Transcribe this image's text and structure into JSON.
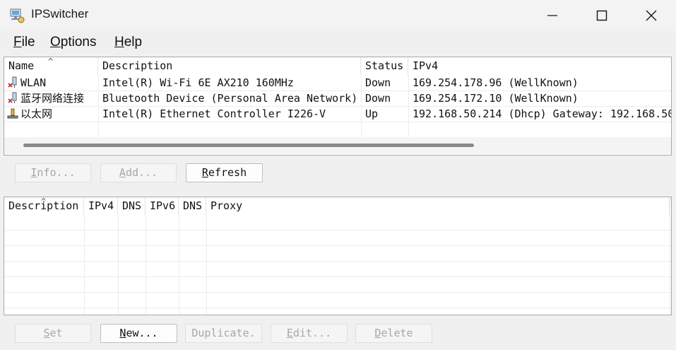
{
  "window": {
    "title": "IPSwitcher",
    "controls": {
      "minimize": "minimize",
      "maximize": "maximize",
      "close": "close"
    }
  },
  "menu": {
    "file": {
      "mnemonic": "F",
      "rest": "ile"
    },
    "options": {
      "mnemonic": "O",
      "rest": "ptions"
    },
    "help": {
      "mnemonic": "H",
      "rest": "elp"
    }
  },
  "adapters": {
    "columns": [
      "Name",
      "Description",
      "Status",
      "IPv4"
    ],
    "sort_indicator": "^",
    "rows": [
      {
        "name": "WLAN",
        "description": "Intel(R) Wi-Fi 6E AX210 160MHz",
        "status": "Down",
        "ipv4": "169.254.178.96 (WellKnown)",
        "icon": "network-disconnected-icon"
      },
      {
        "name": "蓝牙网络连接",
        "description": "Bluetooth Device (Personal Area Network)",
        "status": "Down",
        "ipv4": "169.254.172.10 (WellKnown)",
        "icon": "network-disconnected-icon"
      },
      {
        "name": "以太网",
        "description": "Intel(R) Ethernet Controller I226-V",
        "status": "Up",
        "ipv4": "192.168.50.214 (Dhcp) Gateway: 192.168.50",
        "icon": "network-connected-icon"
      }
    ]
  },
  "adapter_buttons": {
    "info": {
      "mnemonic": "I",
      "rest": "nfo..."
    },
    "add": {
      "mnemonic": "A",
      "rest": "dd..."
    },
    "refresh": {
      "mnemonic": "R",
      "rest": "efresh"
    }
  },
  "profiles": {
    "columns": [
      "Description",
      "IPv4",
      "DNS",
      "IPv6",
      "DNS",
      "Proxy"
    ],
    "sort_indicator": "^",
    "rows": []
  },
  "profile_buttons": {
    "set": {
      "mnemonic": "S",
      "rest": "et"
    },
    "new": {
      "mnemonic": "N",
      "rest": "ew..."
    },
    "duplicate": "Duplicate.",
    "edit": {
      "mnemonic": "E",
      "rest": "dit..."
    },
    "delete": {
      "mnemonic": "D",
      "rest": "elete"
    }
  },
  "colors": {
    "window_bg": "#f0f0f0",
    "list_bg": "#ffffff",
    "disabled_text": "#a7a7a7",
    "scroll_thumb": "#8a8a8a"
  }
}
